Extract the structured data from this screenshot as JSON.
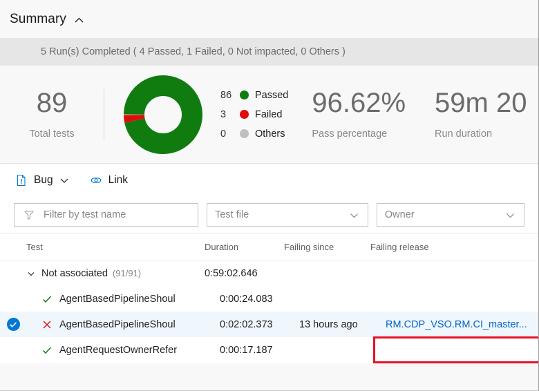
{
  "summary": {
    "title": "Summary",
    "collapse_icon": "chevron-up-icon",
    "run_status": "5 Run(s) Completed ( 4 Passed, 1 Failed, 0 Not impacted, 0 Others )"
  },
  "metrics": {
    "total": {
      "value": "89",
      "label": "Total tests"
    },
    "pass_percentage": {
      "value": "96.62%",
      "label": "Pass percentage"
    },
    "run_duration": {
      "value": "59m 20",
      "label": "Run duration"
    }
  },
  "chart_data": {
    "type": "pie",
    "title": "Test outcome distribution",
    "categories": [
      "Passed",
      "Failed",
      "Others"
    ],
    "values": [
      86,
      3,
      0
    ],
    "colors": [
      "#107c10",
      "#e00b0b",
      "#bfbfbf"
    ],
    "donut": true,
    "legend_position": "right",
    "legend": [
      {
        "count": "86",
        "label": "Passed",
        "color": "#107c10"
      },
      {
        "count": "3",
        "label": "Failed",
        "color": "#e00b0b"
      },
      {
        "count": "0",
        "label": "Others",
        "color": "#bfbfbf"
      }
    ]
  },
  "toolbar": {
    "bug": {
      "label": "Bug",
      "icon": "bug-file-icon",
      "caret": "chevron-down-icon"
    },
    "link": {
      "label": "Link",
      "icon": "link-icon"
    }
  },
  "filters": {
    "test_name": {
      "placeholder": "Filter by test name",
      "value": "",
      "icon": "funnel-icon"
    },
    "test_file": {
      "value": "Test file",
      "caret": "chevron-down-icon"
    },
    "owner": {
      "value": "Owner",
      "caret": "chevron-down-icon"
    }
  },
  "table": {
    "columns": {
      "test": "Test",
      "duration": "Duration",
      "failing_since": "Failing since",
      "failing_release": "Failing release"
    },
    "rows": [
      {
        "kind": "group",
        "expander": "chevron-down-icon",
        "name": "Not associated",
        "count": "(91/91)",
        "duration": "0:59:02.646",
        "failing_since": "",
        "failing_release": ""
      },
      {
        "kind": "test",
        "status": "passed",
        "status_icon": "check-icon",
        "name": "AgentBasedPipelineShoul",
        "duration": "0:00:24.083",
        "failing_since": "",
        "failing_release": "",
        "selected": false
      },
      {
        "kind": "test",
        "status": "failed",
        "status_icon": "x-icon",
        "name": "AgentBasedPipelineShoul",
        "duration": "0:02:02.373",
        "failing_since": "13 hours ago",
        "failing_release": "RM.CDP_VSO.RM.CI_master...",
        "selected": true
      },
      {
        "kind": "test",
        "status": "passed",
        "status_icon": "check-icon",
        "name": "AgentRequestOwnerRefer",
        "duration": "0:00:17.187",
        "failing_since": "",
        "failing_release": "",
        "selected": false
      }
    ]
  },
  "annotation": {
    "shape": "rectangle",
    "color": "#e81123",
    "target": "failing-release-link"
  }
}
